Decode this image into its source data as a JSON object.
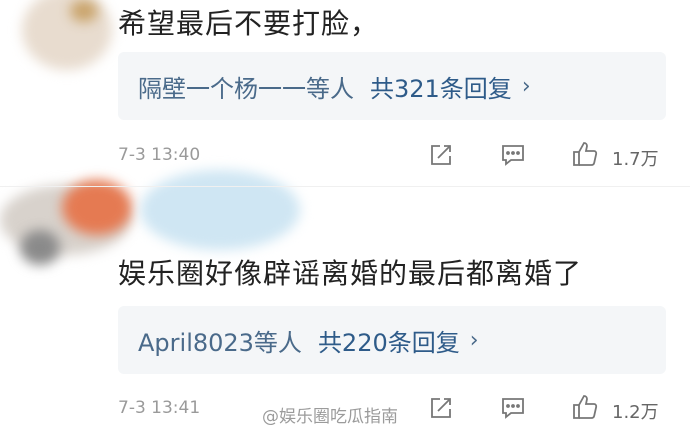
{
  "comments": [
    {
      "text": "希望最后不要打脸，",
      "reply_users": "隔壁一个杨一一等人",
      "reply_count": "共321条回复",
      "chevron": "›",
      "timestamp": "7-3 13:40",
      "likes": "1.7万"
    },
    {
      "text": "娱乐圈好像辟谣离婚的最后都离婚了",
      "reply_users": "April8023等人",
      "reply_count": "共220条回复",
      "chevron": "›",
      "timestamp": "7-3 13:41",
      "likes": "1.2万"
    }
  ],
  "watermark": "@娱乐圈吃瓜指南",
  "icons": [
    "share-icon",
    "comment-icon",
    "like-icon"
  ],
  "colors": {
    "link": "#2e5b89",
    "reply_bg": "#f4f6f8",
    "meta": "#9a9a9a"
  }
}
